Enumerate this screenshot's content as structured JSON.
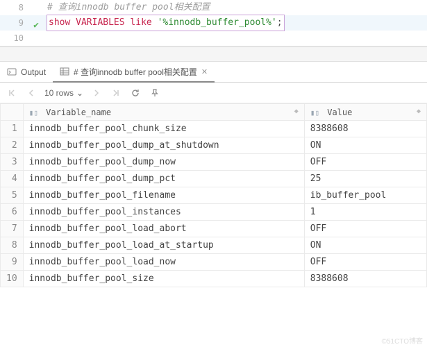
{
  "editor": {
    "lines": [
      {
        "num": "8",
        "type": "comment",
        "text": "# 查询innodb buffer pool相关配置"
      },
      {
        "num": "9",
        "type": "sql",
        "active": true,
        "check": true,
        "tokens": {
          "kw1": "show",
          "kw2": "VARIABLES",
          "kw3": "like",
          "str": "'%innodb_buffer_pool%'",
          "tail": ";"
        }
      },
      {
        "num": "10",
        "type": "blank",
        "text": ""
      }
    ]
  },
  "tabs": {
    "output": {
      "label": "Output"
    },
    "result": {
      "label": "# 查询innodb buffer pool相关配置"
    }
  },
  "toolbar": {
    "rows_label": "10 rows"
  },
  "table": {
    "headers": {
      "variable": "Variable_name",
      "value": "Value"
    },
    "rows": [
      {
        "n": "1",
        "variable": "innodb_buffer_pool_chunk_size",
        "value": "8388608"
      },
      {
        "n": "2",
        "variable": "innodb_buffer_pool_dump_at_shutdown",
        "value": "ON"
      },
      {
        "n": "3",
        "variable": "innodb_buffer_pool_dump_now",
        "value": "OFF"
      },
      {
        "n": "4",
        "variable": "innodb_buffer_pool_dump_pct",
        "value": "25"
      },
      {
        "n": "5",
        "variable": "innodb_buffer_pool_filename",
        "value": "ib_buffer_pool"
      },
      {
        "n": "6",
        "variable": "innodb_buffer_pool_instances",
        "value": "1"
      },
      {
        "n": "7",
        "variable": "innodb_buffer_pool_load_abort",
        "value": "OFF"
      },
      {
        "n": "8",
        "variable": "innodb_buffer_pool_load_at_startup",
        "value": "ON"
      },
      {
        "n": "9",
        "variable": "innodb_buffer_pool_load_now",
        "value": "OFF"
      },
      {
        "n": "10",
        "variable": "innodb_buffer_pool_size",
        "value": "8388608"
      }
    ]
  },
  "watermark": "©51CTO博客"
}
